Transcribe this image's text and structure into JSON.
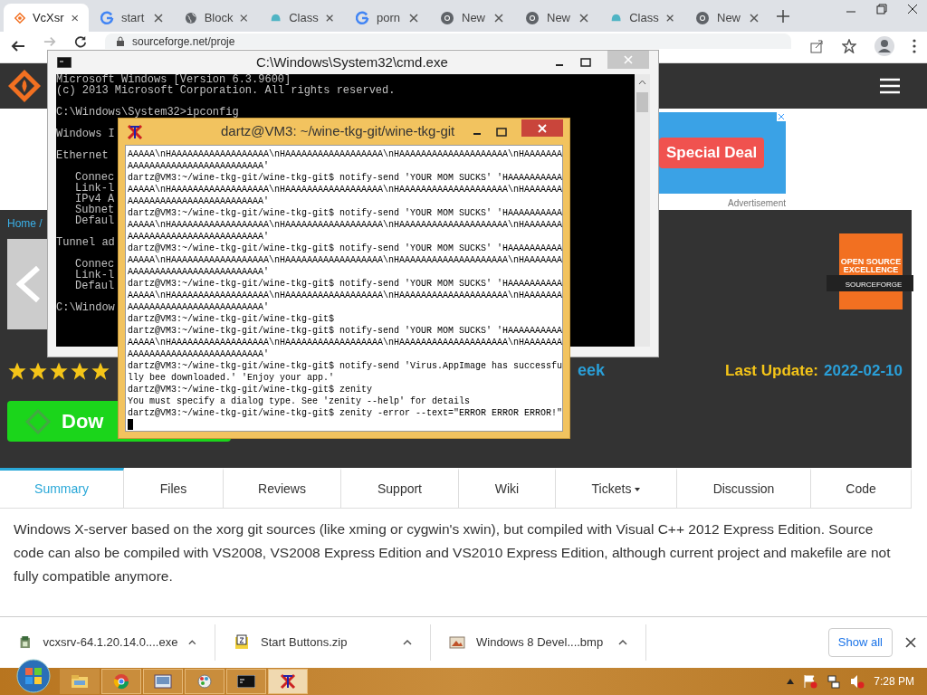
{
  "browser": {
    "tabs": [
      {
        "title": "VcXsr",
        "kind": "sourceforge",
        "selected": true
      },
      {
        "title": "start",
        "kind": "google",
        "selected": false
      },
      {
        "title": "Block",
        "kind": "globe",
        "selected": false
      },
      {
        "title": "Class",
        "kind": "shell",
        "selected": false
      },
      {
        "title": "porn",
        "kind": "google",
        "selected": false
      },
      {
        "title": "New",
        "kind": "chrome",
        "selected": false
      },
      {
        "title": "New",
        "kind": "chrome",
        "selected": false
      },
      {
        "title": "Class",
        "kind": "shell",
        "selected": false
      },
      {
        "title": "New",
        "kind": "chrome",
        "selected": false
      }
    ],
    "address": "sourceforge.net/proje"
  },
  "page": {
    "ad": {
      "button": "Special Deal",
      "label": "Advertisement"
    },
    "breadcrumb": "Home /",
    "badge": {
      "line1": "OPEN SOURCE",
      "line2": "EXCELLENCE",
      "brand": "SOURCEFORGE"
    },
    "stars": 5,
    "weekly_fragment": "eek",
    "last_update_label": "Last Update:",
    "last_update": "2022-02-10",
    "download_button": "Dow",
    "tabs": [
      {
        "label": "Summary",
        "selected": true,
        "dropdown": false
      },
      {
        "label": "Files",
        "selected": false,
        "dropdown": false
      },
      {
        "label": "Reviews",
        "selected": false,
        "dropdown": false
      },
      {
        "label": "Support",
        "selected": false,
        "dropdown": false
      },
      {
        "label": "Wiki",
        "selected": false,
        "dropdown": false
      },
      {
        "label": "Tickets",
        "selected": false,
        "dropdown": true
      },
      {
        "label": "Discussion",
        "selected": false,
        "dropdown": false
      },
      {
        "label": "Code",
        "selected": false,
        "dropdown": false
      }
    ],
    "description": "Windows X-server based on the xorg git sources (like xming or cygwin's xwin), but compiled with Visual C++ 2012 Express Edition. Source code can also be compiled with VS2008, VS2008 Express Edition and VS2010 Express Edition, although current project and makefile are not fully compatible anymore."
  },
  "downloads": {
    "items": [
      {
        "name": "vcxsrv-64.1.20.14.0....exe",
        "kind": "installer"
      },
      {
        "name": "Start Buttons.zip",
        "kind": "zip"
      },
      {
        "name": "Windows 8 Devel....bmp",
        "kind": "image"
      }
    ],
    "show_all": "Show all"
  },
  "cmd": {
    "title": "C:\\Windows\\System32\\cmd.exe",
    "blocks": [
      {
        "kind": "plain",
        "lines": [
          "Microsoft Windows [Version 6.3.9600]",
          "(c) 2013 Microsoft Corporation. All rights reserved."
        ]
      },
      {
        "kind": "plain",
        "lines": [
          "C:\\Windows\\System32>ipconfig"
        ]
      },
      {
        "kind": "plain",
        "lines": [
          "Windows I"
        ]
      },
      {
        "kind": "plain",
        "lines": [
          "Ethernet"
        ]
      },
      {
        "kind": "indented",
        "lines": [
          "Connec",
          "Link-l",
          "IPv4 A",
          "Subnet",
          "Defaul"
        ]
      },
      {
        "kind": "plain",
        "lines": [
          "Tunnel ad"
        ]
      },
      {
        "kind": "indented",
        "lines": [
          "Connec",
          "Link-l",
          "Defaul"
        ]
      },
      {
        "kind": "plain",
        "lines": [
          "C:\\Window"
        ]
      }
    ]
  },
  "xterm": {
    "title": "dartz@VM3: ~/wine-tkg-git/wine-tkg-git",
    "lines": [
      "AAAAA\\nHAAAAAAAAAAAAAAAAAA\\nHAAAAAAAAAAAAAAAAAA\\nHAAAAAAAAAAAAAAAAAAAA\\nHAAAAAAA",
      "AAAAAAAAAAAAAAAAAAAAAAAAA'",
      "dartz@VM3:~/wine-tkg-git/wine-tkg-git$ notify-send 'YOUR MOM SUCKS' 'HAAAAAAAAAA",
      "AAAAA\\nHAAAAAAAAAAAAAAAAAA\\nHAAAAAAAAAAAAAAAAAA\\nHAAAAAAAAAAAAAAAAAAAA\\nHAAAAAAA",
      "AAAAAAAAAAAAAAAAAAAAAAAAA'",
      "dartz@VM3:~/wine-tkg-git/wine-tkg-git$ notify-send 'YOUR MOM SUCKS' 'HAAAAAAAAAA",
      "AAAAA\\nHAAAAAAAAAAAAAAAAAA\\nHAAAAAAAAAAAAAAAAAA\\nHAAAAAAAAAAAAAAAAAAAA\\nHAAAAAAA",
      "AAAAAAAAAAAAAAAAAAAAAAAAA'",
      "dartz@VM3:~/wine-tkg-git/wine-tkg-git$ notify-send 'YOUR MOM SUCKS' 'HAAAAAAAAAA",
      "AAAAA\\nHAAAAAAAAAAAAAAAAAA\\nHAAAAAAAAAAAAAAAAAA\\nHAAAAAAAAAAAAAAAAAAAA\\nHAAAAAAA",
      "AAAAAAAAAAAAAAAAAAAAAAAAA'",
      "dartz@VM3:~/wine-tkg-git/wine-tkg-git$ notify-send 'YOUR MOM SUCKS' 'HAAAAAAAAAA",
      "AAAAA\\nHAAAAAAAAAAAAAAAAAA\\nHAAAAAAAAAAAAAAAAAA\\nHAAAAAAAAAAAAAAAAAAAA\\nHAAAAAAA",
      "AAAAAAAAAAAAAAAAAAAAAAAAA'",
      "dartz@VM3:~/wine-tkg-git/wine-tkg-git$",
      "dartz@VM3:~/wine-tkg-git/wine-tkg-git$ notify-send 'YOUR MOM SUCKS' 'HAAAAAAAAAA",
      "AAAAA\\nHAAAAAAAAAAAAAAAAAA\\nHAAAAAAAAAAAAAAAAAA\\nHAAAAAAAAAAAAAAAAAAAA\\nHAAAAAAA",
      "AAAAAAAAAAAAAAAAAAAAAAAAA'",
      "dartz@VM3:~/wine-tkg-git/wine-tkg-git$ notify-send 'Virus.AppImage has successfu",
      "lly bee downloaded.' 'Enjoy your app.'",
      "dartz@VM3:~/wine-tkg-git/wine-tkg-git$ zenity",
      "You must specify a dialog type. See 'zenity --help' for details",
      "dartz@VM3:~/wine-tkg-git/wine-tkg-git$ zenity -error --text=\"ERROR ERROR ERROR!\""
    ]
  },
  "taskbar": {
    "apps": [
      {
        "kind": "explorer",
        "selected": false
      },
      {
        "kind": "chrome",
        "selected": false
      },
      {
        "kind": "viewer",
        "selected": false
      },
      {
        "kind": "paint",
        "selected": false
      },
      {
        "kind": "cmd",
        "selected": false
      },
      {
        "kind": "xterm",
        "selected": true
      }
    ],
    "clock": "7:28 PM"
  }
}
